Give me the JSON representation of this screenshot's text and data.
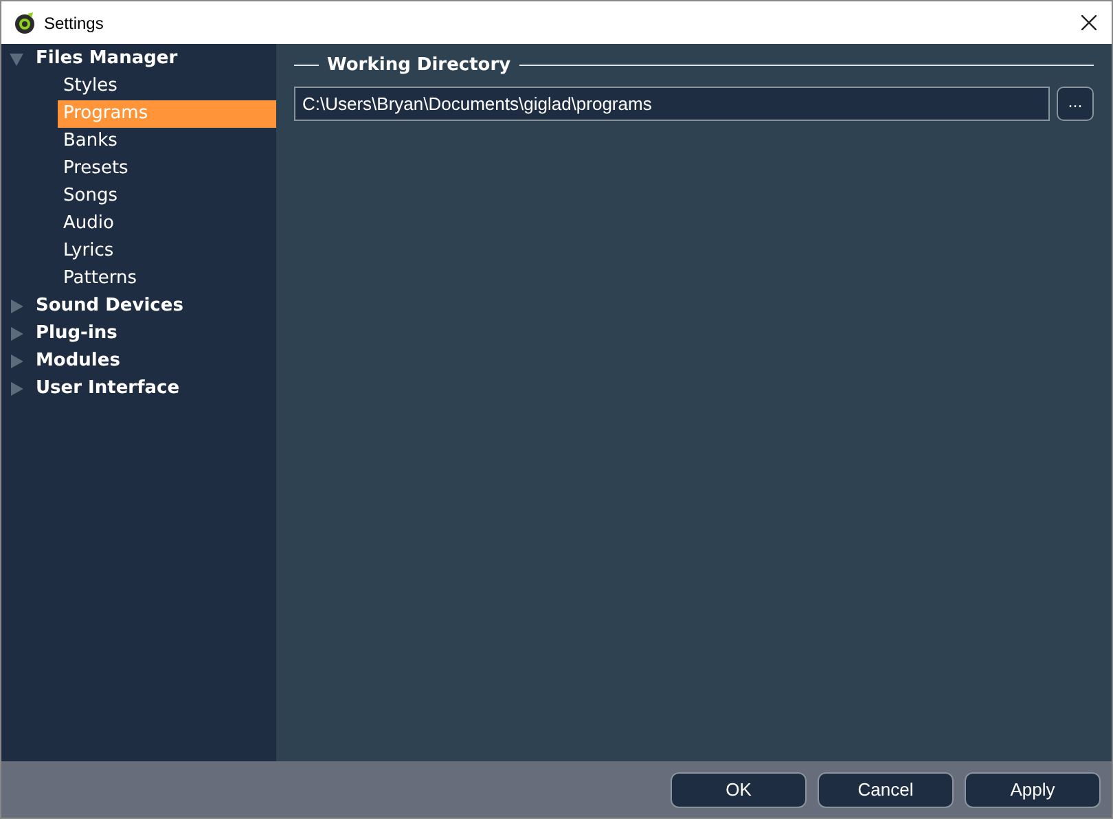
{
  "window": {
    "title": "Settings"
  },
  "sidebar": {
    "items": [
      {
        "label": "Files Manager",
        "expanded": true,
        "selected": false,
        "children": [
          {
            "label": "Styles",
            "selected": false
          },
          {
            "label": "Programs",
            "selected": true
          },
          {
            "label": "Banks",
            "selected": false
          },
          {
            "label": "Presets",
            "selected": false
          },
          {
            "label": "Songs",
            "selected": false
          },
          {
            "label": "Audio",
            "selected": false
          },
          {
            "label": "Lyrics",
            "selected": false
          },
          {
            "label": "Patterns",
            "selected": false
          }
        ]
      },
      {
        "label": "Sound Devices",
        "expanded": false,
        "selected": false
      },
      {
        "label": "Plug-ins",
        "expanded": false,
        "selected": false
      },
      {
        "label": "Modules",
        "expanded": false,
        "selected": false
      },
      {
        "label": "User Interface",
        "expanded": false,
        "selected": false
      }
    ]
  },
  "section": {
    "title": "Working Directory",
    "path": "C:\\Users\\Bryan\\Documents\\giglad\\programs",
    "browse": "..."
  },
  "buttons": [
    "OK",
    "Cancel",
    "Apply"
  ]
}
